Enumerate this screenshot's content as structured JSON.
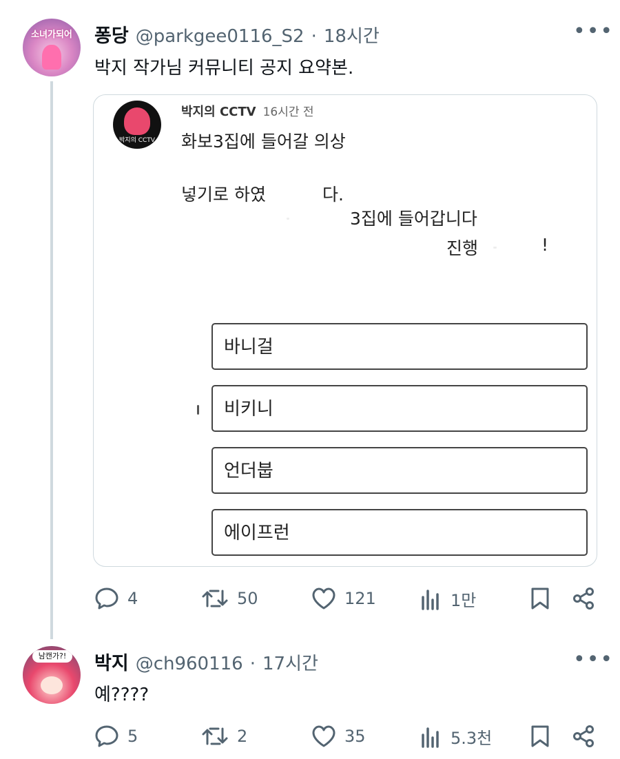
{
  "tweet1": {
    "name": "퐁당",
    "handle": "@parkgee0116_S2",
    "time": "18시간",
    "text": "박지 작가님 커뮤니티 공지 요약본.",
    "avatar_text": "소녀가되어",
    "more_icon": "more-horizontal-icon",
    "embed": {
      "channel": "박지의 CCTV",
      "time": "16시간 전",
      "avatar_text": "박지의 CCTV",
      "line1": "화보3집에 들어갈 의상",
      "line2": "넣기로 하였",
      "line2b": "다.",
      "line3": "3집에 들어갑니다",
      "line4": "진행",
      "line4b": "!",
      "options": [
        "바니걸",
        "비키니",
        "언더붑",
        "에이프런"
      ]
    },
    "actions": {
      "replies": "4",
      "retweets": "50",
      "likes": "121",
      "views": "1만"
    }
  },
  "tweet2": {
    "name": "박지",
    "handle": "@ch960116",
    "time": "17시간",
    "text": "예????",
    "avatar_text": "남캔가?!",
    "actions": {
      "replies": "5",
      "retweets": "2",
      "likes": "35",
      "views": "5.3천"
    }
  },
  "colors": {
    "text": "#0f1419",
    "secondary": "#536471",
    "border": "#cfd9de",
    "accent_pink": "#e0457b"
  },
  "icons": [
    "reply-icon",
    "retweet-icon",
    "like-icon",
    "views-icon",
    "bookmark-icon",
    "share-icon"
  ]
}
